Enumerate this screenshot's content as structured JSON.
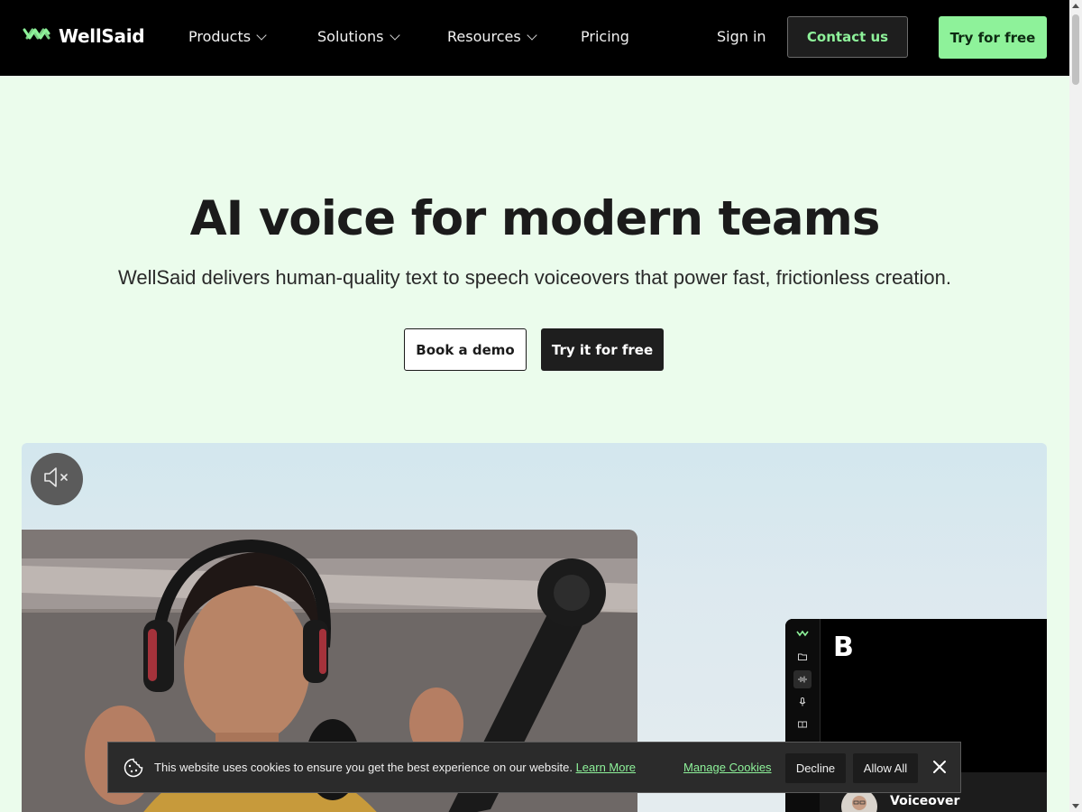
{
  "header": {
    "brand": "WellSaid",
    "nav": [
      {
        "label": "Products",
        "has_dropdown": true
      },
      {
        "label": "Solutions",
        "has_dropdown": true
      },
      {
        "label": "Resources",
        "has_dropdown": true
      },
      {
        "label": "Pricing",
        "has_dropdown": false
      }
    ],
    "sign_in": "Sign in",
    "contact": "Contact us",
    "try_free": "Try for free"
  },
  "hero": {
    "title": "AI voice for modern teams",
    "subtitle": "WellSaid delivers human-quality text to speech voiceovers that power fast, frictionless creation.",
    "demo_button": "Book a demo",
    "try_button": "Try it for free"
  },
  "media": {
    "mute_icon": "speaker-muted-icon",
    "app_preview": {
      "letter": "B",
      "voice_label": "Voiceover"
    }
  },
  "cookie_banner": {
    "text": "This website uses cookies to ensure you get the best experience on our website.",
    "learn_more": "Learn More",
    "manage": "Manage Cookies",
    "decline": "Decline",
    "allow_all": "Allow All"
  },
  "colors": {
    "accent_green": "#8ef29a",
    "page_bg": "#ebfcec",
    "header_bg": "#000000"
  }
}
